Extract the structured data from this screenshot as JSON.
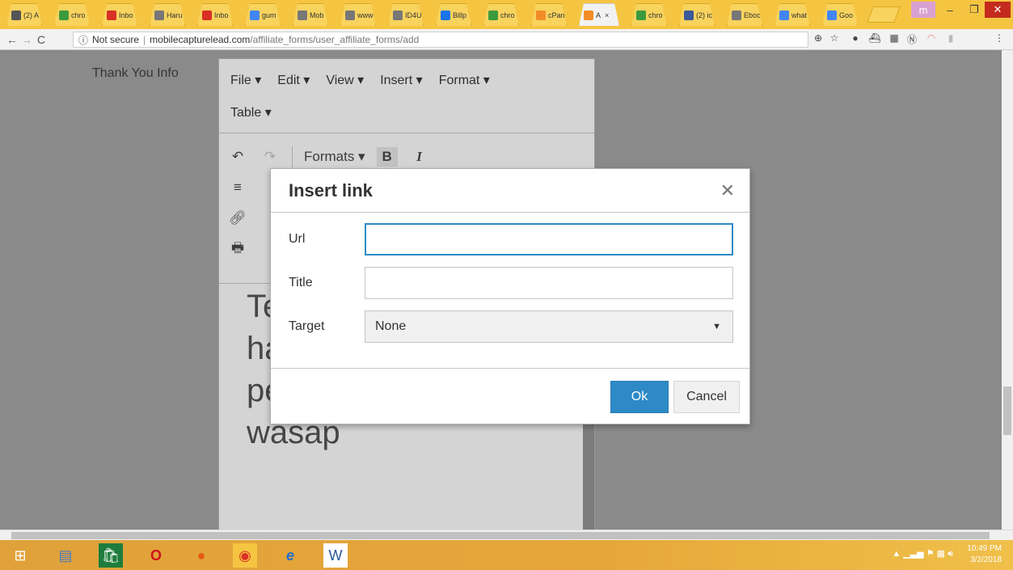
{
  "browser": {
    "tabs": [
      {
        "label": "(2) A",
        "color": "#555"
      },
      {
        "label": "chro",
        "color": "#3c9a3c"
      },
      {
        "label": "Inbo",
        "color": "#d93025"
      },
      {
        "label": "Haru",
        "color": "#777"
      },
      {
        "label": "Inbo",
        "color": "#d93025"
      },
      {
        "label": "gum",
        "color": "#4285f4"
      },
      {
        "label": "Mob",
        "color": "#777"
      },
      {
        "label": "www",
        "color": "#777"
      },
      {
        "label": "ID4U",
        "color": "#777"
      },
      {
        "label": "Billp",
        "color": "#1a73e8"
      },
      {
        "label": "chro",
        "color": "#3c9a3c"
      },
      {
        "label": "cPan",
        "color": "#f28c28"
      },
      {
        "label": "A",
        "color": "#f28c28",
        "active": true
      },
      {
        "label": "chro",
        "color": "#3c9a3c"
      },
      {
        "label": "(2) ic",
        "color": "#3b5998"
      },
      {
        "label": "Eboc",
        "color": "#777"
      },
      {
        "label": "what",
        "color": "#4285f4"
      },
      {
        "label": "Goo",
        "color": "#4285f4"
      }
    ],
    "security_label": "Not secure",
    "url_host": "mobilecapturelead.com",
    "url_path": "/affiliate_forms/user_affiliate_forms/add",
    "user_badge": "m"
  },
  "page": {
    "thank_you_label": "Thank You Info"
  },
  "editor": {
    "menu_row1": [
      "File ▾",
      "Edit ▾",
      "View ▾",
      "Insert ▾",
      "Format ▾"
    ],
    "menu_row2": [
      "Table ▾"
    ],
    "formats_label": "Formats ▾",
    "bold_label": "B",
    "italic_label": "I",
    "content_lines": [
      "Te",
      "ha",
      "pembelian anda di",
      "wasap"
    ]
  },
  "dialog": {
    "title": "Insert link",
    "close_glyph": "✕",
    "url_label": "Url",
    "url_value": "",
    "title_label": "Title",
    "title_value": "",
    "target_label": "Target",
    "target_value": "None",
    "ok_label": "Ok",
    "cancel_label": "Cancel"
  },
  "taskbar": {
    "time": "10:49 PM",
    "date": "3/2/2018"
  },
  "colors": {
    "accent": "#2d8ac7",
    "tabstrip": "#f5c542",
    "taskbar": "#e6a73a"
  }
}
